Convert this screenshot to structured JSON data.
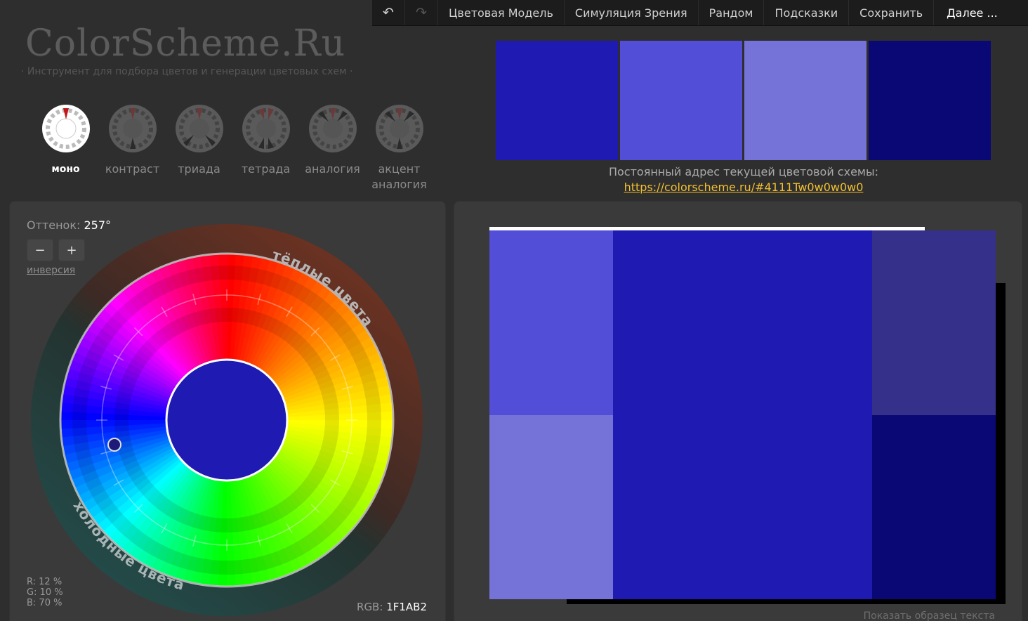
{
  "nav": {
    "undo_icon": "undo-icon",
    "redo_icon": "redo-icon",
    "undo_glyph": "↶",
    "redo_glyph": "↷",
    "items": [
      "Цветовая Модель",
      "Симуляция Зрения",
      "Рандом",
      "Подсказки",
      "Сохранить",
      "Далее ..."
    ]
  },
  "logo": "ColorScheme.Ru",
  "tagline": "· Инструмент для подбора цветов и генерации цветовых схем ·",
  "modes": [
    {
      "label": "моно",
      "active": true
    },
    {
      "label": "контраст",
      "active": false
    },
    {
      "label": "триада",
      "active": false
    },
    {
      "label": "тетрада",
      "active": false
    },
    {
      "label": "аналогия",
      "active": false
    },
    {
      "label": "акцент аналогия",
      "active": false
    }
  ],
  "swatches": [
    "#1F1AB2",
    "#524ED8",
    "#7673D8",
    "#0A0875"
  ],
  "permalink": {
    "label": "Постоянный адрес текущей цветовой схемы:",
    "url": "https://colorscheme.ru/#4111Tw0w0w0w0"
  },
  "hue": {
    "label": "Оттенок:",
    "value": "257°",
    "minus": "−",
    "plus": "+",
    "invert": "инверсия"
  },
  "wheel": {
    "warm_label": "тёплые цвета",
    "cold_label": "холодные цвета",
    "center_color": "#1F1AB2"
  },
  "rgb": {
    "r": "R: 12 %",
    "g": "G: 10 %",
    "b": "B: 70 %",
    "hex_label": "RGB:",
    "hex_value": "1F1AB2"
  },
  "preview": {
    "colors": {
      "main": "#1F1AB2",
      "light1": "#524ED8",
      "light2": "#7673D8",
      "dark1": "#35318A",
      "dark2": "#0A0875"
    },
    "show_sample": "Показать образец текста"
  }
}
